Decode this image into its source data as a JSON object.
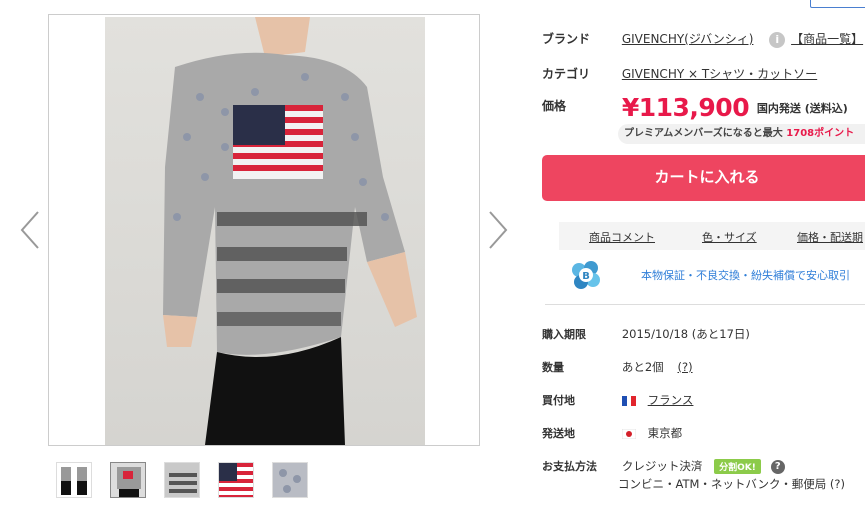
{
  "product": {
    "brand_label": "ブランド",
    "brand_link": "GIVENCHY(ジバンシィ)",
    "brand_list_link": "【商品一覧】",
    "category_label": "カテゴリ",
    "category_link": "GIVENCHY × Tシャツ・カットソー",
    "price_label": "価格",
    "price": "¥113,900",
    "shipping": "国内発送 (送料込)",
    "premium_text": "プレミアムメンバーズになると最大",
    "premium_points": "1708ポイント",
    "cart_button": "カートに入れる"
  },
  "tabs": [
    "商品コメント",
    "色・サイズ",
    "価格・配送期"
  ],
  "guarantee_text": "本物保証・不良交換・紛失補償で安心取引",
  "details": {
    "deadline_label": "購入期限",
    "deadline_value": "2015/10/18 (あと17日)",
    "quantity_label": "数量",
    "quantity_value": "あと2個",
    "quantity_help": "(?)",
    "buy_place_label": "買付地",
    "buy_place_value": "フランス",
    "ship_from_label": "発送地",
    "ship_from_value": "東京都",
    "payment_label": "お支払方法",
    "payment_value1": "クレジット決済",
    "payment_badge": "分割OK!",
    "payment_value2": "コンビニ・ATM・ネットバンク・郵便局 (?)"
  },
  "icons": {
    "prev": "chevron-left-icon",
    "next": "chevron-right-icon",
    "info": "info-icon",
    "help": "question-icon",
    "guarantee": "b-shield-logo",
    "flag_fr": "france-flag-icon",
    "flag_jp": "japan-flag-icon"
  },
  "colors": {
    "accent_price": "#e8194a",
    "cart_button": "#ee4560",
    "guarantee_text": "#2f7ed8",
    "ok_badge": "#8ccb4a"
  }
}
